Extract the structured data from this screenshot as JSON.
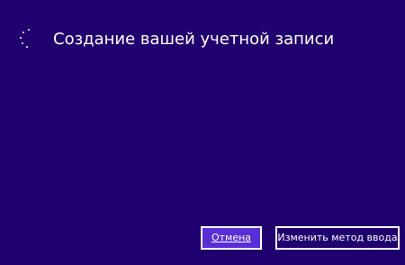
{
  "status": {
    "title": "Создание вашей учетной записи",
    "spinner_icon": "loading-spinner-icon"
  },
  "actions": {
    "cancel_label": "Отмена",
    "change_input_label": "Изменить метод ввода"
  },
  "colors": {
    "background": "#1f006e",
    "primary_button": "#5a2ed6",
    "foreground": "#ffffff"
  }
}
